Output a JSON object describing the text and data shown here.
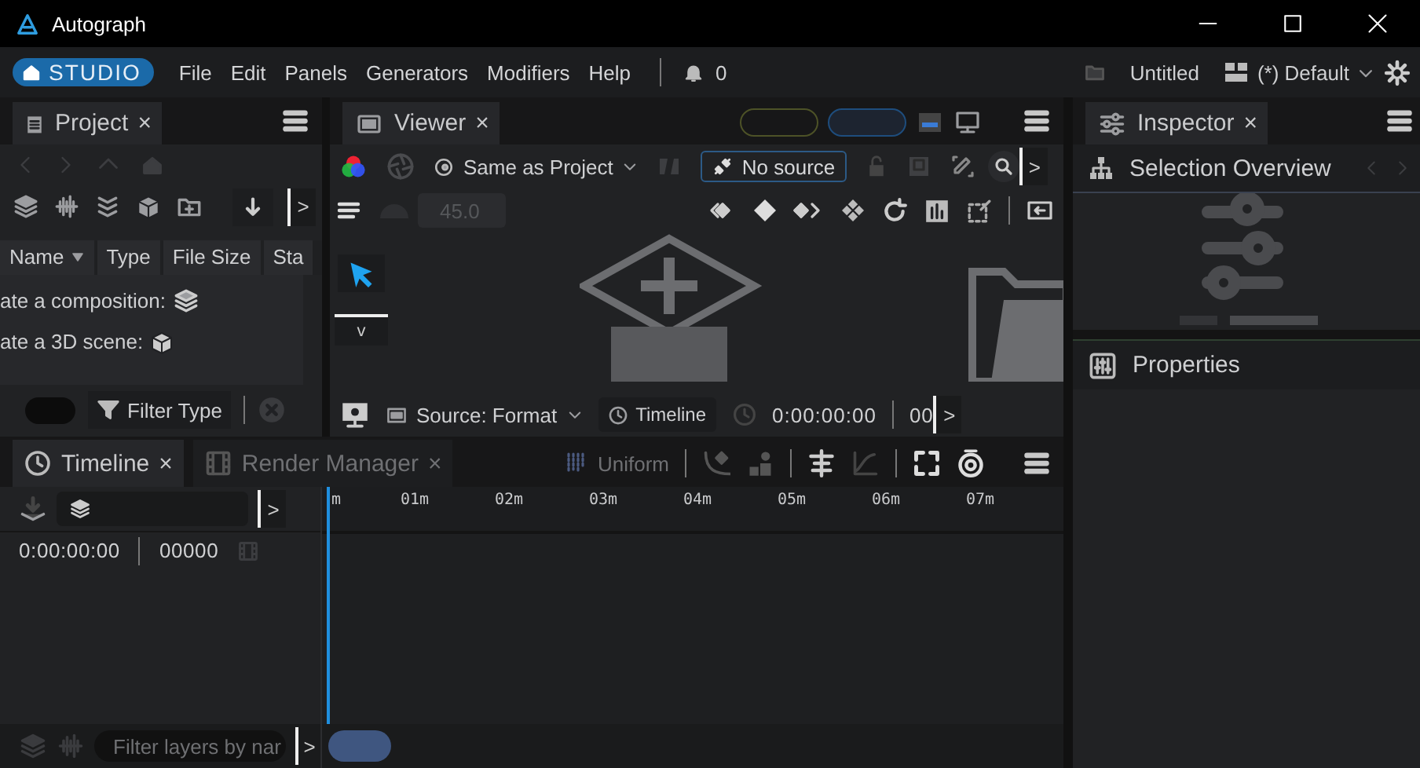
{
  "window": {
    "title": "Autograph"
  },
  "menubar": {
    "home": "STUDIO",
    "menus": [
      "File",
      "Edit",
      "Panels",
      "Generators",
      "Modifiers",
      "Help"
    ],
    "notifications": "0",
    "project": "Untitled",
    "layout": "(*) Default"
  },
  "project_panel": {
    "tab": {
      "label": "Project",
      "close": "×"
    },
    "overflow": ">",
    "columns": [
      "Name",
      "Type",
      "File Size",
      "Sta"
    ],
    "hints": [
      "ate a composition:",
      "ate a 3D scene:"
    ],
    "toggle": {
      "on": false
    },
    "filter": "Filter Type"
  },
  "viewer": {
    "tab": {
      "label": "Viewer",
      "close": "×"
    },
    "color_space": "Same as Project",
    "source": "No source",
    "overflow": ">",
    "zoom": "45.0",
    "tool_menu": "v",
    "source_format": "Source: Format",
    "timeline": "Timeline",
    "timecode": "0:00:00:00",
    "frame": "00",
    "overflow_bottom": ">"
  },
  "inspector": {
    "tab": {
      "label": "Inspector",
      "close": "×"
    },
    "selection": "Selection Overview",
    "properties": "Properties"
  },
  "timeline": {
    "tabs": [
      {
        "label": "Timeline",
        "close": "×",
        "selected": true
      },
      {
        "label": "Render Manager",
        "close": "×",
        "selected": false
      }
    ],
    "interpolation": "Uniform",
    "overflow": ">",
    "timecode": "0:00:00:00",
    "frame": "00000",
    "ruler": [
      "m",
      "01m",
      "02m",
      "03m",
      "04m",
      "05m",
      "06m",
      "07m"
    ],
    "filter": {
      "placeholder": "Filter layers by nar"
    },
    "overflow_bottom": ">"
  }
}
